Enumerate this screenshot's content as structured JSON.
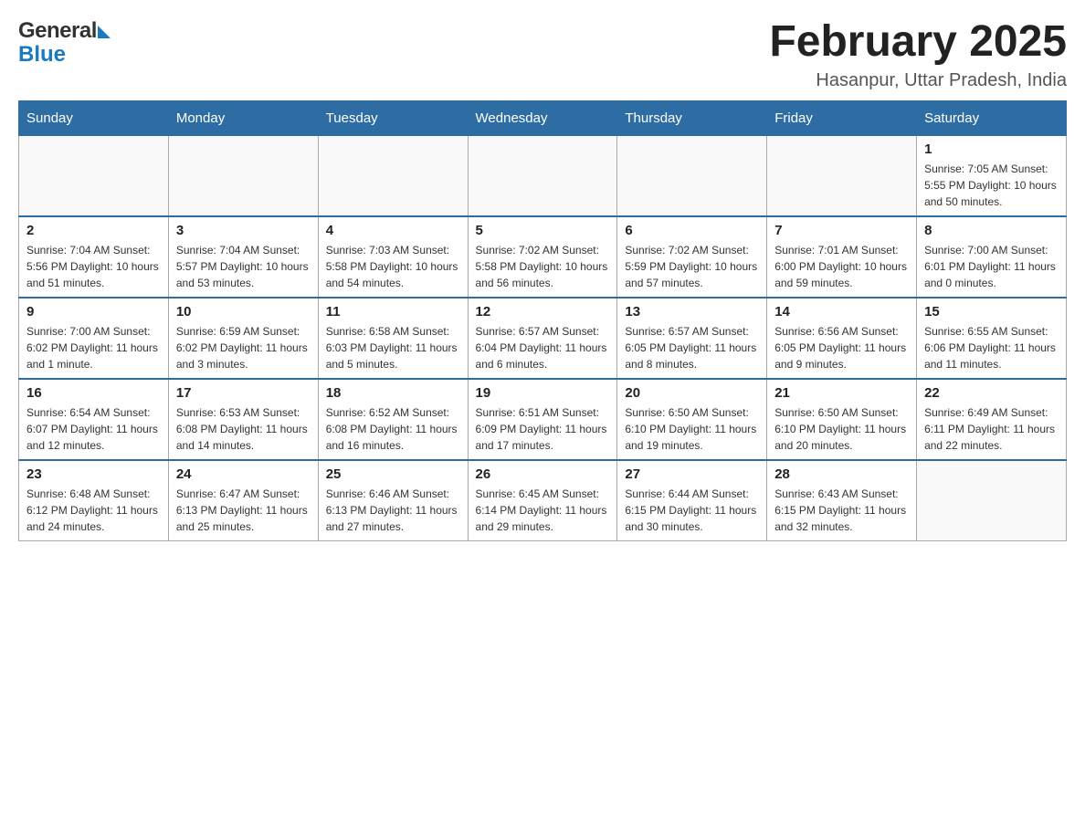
{
  "header": {
    "logo_general": "General",
    "logo_blue": "Blue",
    "month_year": "February 2025",
    "location": "Hasanpur, Uttar Pradesh, India"
  },
  "days_of_week": [
    "Sunday",
    "Monday",
    "Tuesday",
    "Wednesday",
    "Thursday",
    "Friday",
    "Saturday"
  ],
  "weeks": [
    {
      "days": [
        {
          "date": "",
          "info": ""
        },
        {
          "date": "",
          "info": ""
        },
        {
          "date": "",
          "info": ""
        },
        {
          "date": "",
          "info": ""
        },
        {
          "date": "",
          "info": ""
        },
        {
          "date": "",
          "info": ""
        },
        {
          "date": "1",
          "info": "Sunrise: 7:05 AM\nSunset: 5:55 PM\nDaylight: 10 hours and 50 minutes."
        }
      ]
    },
    {
      "days": [
        {
          "date": "2",
          "info": "Sunrise: 7:04 AM\nSunset: 5:56 PM\nDaylight: 10 hours and 51 minutes."
        },
        {
          "date": "3",
          "info": "Sunrise: 7:04 AM\nSunset: 5:57 PM\nDaylight: 10 hours and 53 minutes."
        },
        {
          "date": "4",
          "info": "Sunrise: 7:03 AM\nSunset: 5:58 PM\nDaylight: 10 hours and 54 minutes."
        },
        {
          "date": "5",
          "info": "Sunrise: 7:02 AM\nSunset: 5:58 PM\nDaylight: 10 hours and 56 minutes."
        },
        {
          "date": "6",
          "info": "Sunrise: 7:02 AM\nSunset: 5:59 PM\nDaylight: 10 hours and 57 minutes."
        },
        {
          "date": "7",
          "info": "Sunrise: 7:01 AM\nSunset: 6:00 PM\nDaylight: 10 hours and 59 minutes."
        },
        {
          "date": "8",
          "info": "Sunrise: 7:00 AM\nSunset: 6:01 PM\nDaylight: 11 hours and 0 minutes."
        }
      ]
    },
    {
      "days": [
        {
          "date": "9",
          "info": "Sunrise: 7:00 AM\nSunset: 6:02 PM\nDaylight: 11 hours and 1 minute."
        },
        {
          "date": "10",
          "info": "Sunrise: 6:59 AM\nSunset: 6:02 PM\nDaylight: 11 hours and 3 minutes."
        },
        {
          "date": "11",
          "info": "Sunrise: 6:58 AM\nSunset: 6:03 PM\nDaylight: 11 hours and 5 minutes."
        },
        {
          "date": "12",
          "info": "Sunrise: 6:57 AM\nSunset: 6:04 PM\nDaylight: 11 hours and 6 minutes."
        },
        {
          "date": "13",
          "info": "Sunrise: 6:57 AM\nSunset: 6:05 PM\nDaylight: 11 hours and 8 minutes."
        },
        {
          "date": "14",
          "info": "Sunrise: 6:56 AM\nSunset: 6:05 PM\nDaylight: 11 hours and 9 minutes."
        },
        {
          "date": "15",
          "info": "Sunrise: 6:55 AM\nSunset: 6:06 PM\nDaylight: 11 hours and 11 minutes."
        }
      ]
    },
    {
      "days": [
        {
          "date": "16",
          "info": "Sunrise: 6:54 AM\nSunset: 6:07 PM\nDaylight: 11 hours and 12 minutes."
        },
        {
          "date": "17",
          "info": "Sunrise: 6:53 AM\nSunset: 6:08 PM\nDaylight: 11 hours and 14 minutes."
        },
        {
          "date": "18",
          "info": "Sunrise: 6:52 AM\nSunset: 6:08 PM\nDaylight: 11 hours and 16 minutes."
        },
        {
          "date": "19",
          "info": "Sunrise: 6:51 AM\nSunset: 6:09 PM\nDaylight: 11 hours and 17 minutes."
        },
        {
          "date": "20",
          "info": "Sunrise: 6:50 AM\nSunset: 6:10 PM\nDaylight: 11 hours and 19 minutes."
        },
        {
          "date": "21",
          "info": "Sunrise: 6:50 AM\nSunset: 6:10 PM\nDaylight: 11 hours and 20 minutes."
        },
        {
          "date": "22",
          "info": "Sunrise: 6:49 AM\nSunset: 6:11 PM\nDaylight: 11 hours and 22 minutes."
        }
      ]
    },
    {
      "days": [
        {
          "date": "23",
          "info": "Sunrise: 6:48 AM\nSunset: 6:12 PM\nDaylight: 11 hours and 24 minutes."
        },
        {
          "date": "24",
          "info": "Sunrise: 6:47 AM\nSunset: 6:13 PM\nDaylight: 11 hours and 25 minutes."
        },
        {
          "date": "25",
          "info": "Sunrise: 6:46 AM\nSunset: 6:13 PM\nDaylight: 11 hours and 27 minutes."
        },
        {
          "date": "26",
          "info": "Sunrise: 6:45 AM\nSunset: 6:14 PM\nDaylight: 11 hours and 29 minutes."
        },
        {
          "date": "27",
          "info": "Sunrise: 6:44 AM\nSunset: 6:15 PM\nDaylight: 11 hours and 30 minutes."
        },
        {
          "date": "28",
          "info": "Sunrise: 6:43 AM\nSunset: 6:15 PM\nDaylight: 11 hours and 32 minutes."
        },
        {
          "date": "",
          "info": ""
        }
      ]
    }
  ]
}
